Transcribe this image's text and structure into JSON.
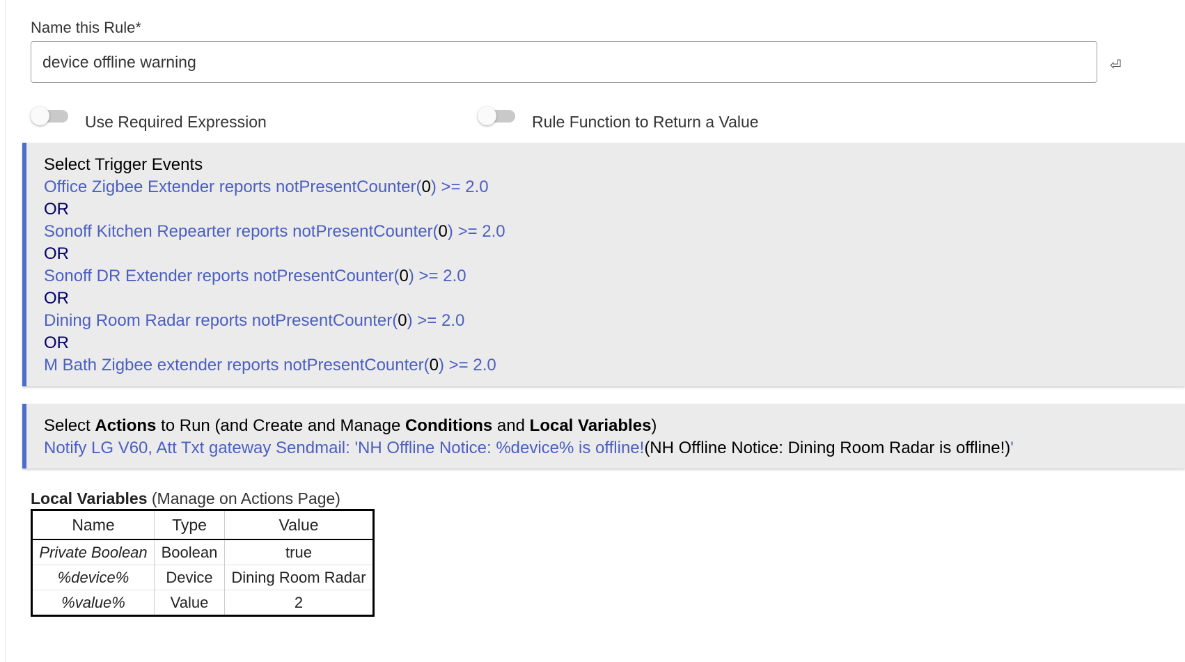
{
  "rule_name": {
    "label": "Name this Rule*",
    "value": "device offline warning",
    "enter_icon": "⏎"
  },
  "toggles": [
    {
      "label": "Use Required Expression",
      "state": "off"
    },
    {
      "label": "Rule Function to Return a Value",
      "state": "off"
    }
  ],
  "triggers": {
    "title": "Select Trigger Events",
    "separator": "OR",
    "items": [
      {
        "prefix": "Office Zigbee Extender reports notPresentCounter(",
        "value": "0",
        "suffix": ") >= 2.0"
      },
      {
        "prefix": "Sonoff Kitchen Repearter reports notPresentCounter(",
        "value": "0",
        "suffix": ") >= 2.0"
      },
      {
        "prefix": "Sonoff DR Extender reports notPresentCounter(",
        "value": "0",
        "suffix": ") >= 2.0"
      },
      {
        "prefix": "Dining Room Radar reports notPresentCounter(",
        "value": "0",
        "suffix": ") >= 2.0"
      },
      {
        "prefix": "M Bath Zigbee extender reports notPresentCounter(",
        "value": "0",
        "suffix": ") >= 2.0"
      }
    ]
  },
  "actions": {
    "title_parts": [
      "Select ",
      "Actions",
      " to Run (and Create and Manage ",
      "Conditions",
      " and ",
      "Local Variables",
      ")"
    ],
    "action_link": "Notify LG V60, Att Txt gateway Sendmail: 'NH Offline Notice: %device% is offline!",
    "action_preview": "(NH Offline Notice: Dining Room Radar is offline!)",
    "action_close": "'"
  },
  "local_variables": {
    "title": "Local Variables",
    "subtitle": " (Manage on Actions Page)",
    "columns": [
      "Name",
      "Type",
      "Value"
    ],
    "rows": [
      {
        "name": "Private Boolean",
        "type": "Boolean",
        "value": "true"
      },
      {
        "name": "%device%",
        "type": "Device",
        "value": "Dining Room Radar"
      },
      {
        "name": "%value%",
        "type": "Value",
        "value": "2"
      }
    ]
  },
  "colors": {
    "accent_border": "#4b6fc9",
    "link": "#4b5fc1",
    "panel_bg": "#ebebeb"
  }
}
